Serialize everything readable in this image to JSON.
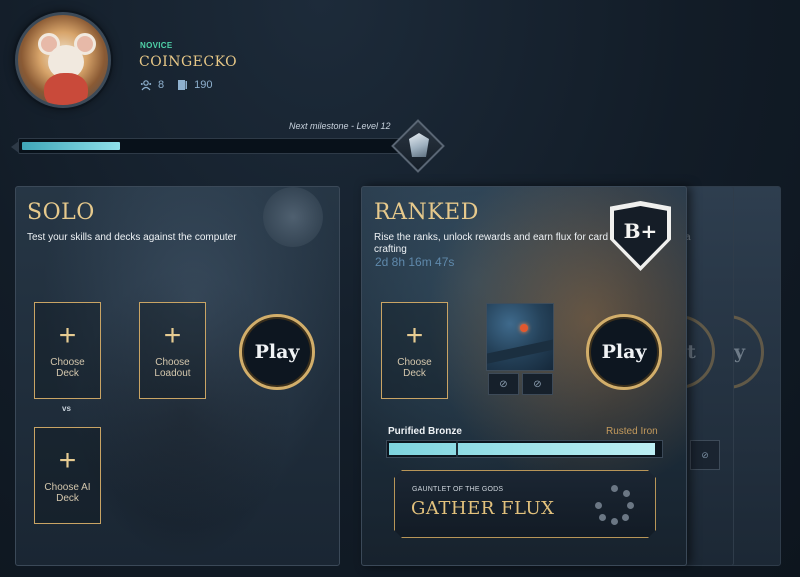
{
  "profile": {
    "rank": "NOVICE",
    "name": "COINGECKO",
    "stats": [
      {
        "icon": "friends-icon",
        "value": "8"
      },
      {
        "icon": "cards-icon",
        "value": "190"
      }
    ]
  },
  "level": {
    "milestone_text": "Next milestone - Level 12",
    "progress": 0.25
  },
  "solo": {
    "title": "SOLO",
    "description": "Test your skills and decks against the computer",
    "slots": [
      {
        "plus": "+",
        "label": "Choose Deck"
      },
      {
        "plus": "+",
        "label": "Choose Loadout"
      },
      {
        "plus": "+",
        "label": "Choose AI Deck"
      }
    ],
    "vs": "vs",
    "play_label": "Play"
  },
  "ranked": {
    "title": "RANKED",
    "description": "Rise the ranks, unlock rewards and earn flux for card crafting",
    "countdown": "2d 8h 16m 47s",
    "grade": "B+",
    "slot": {
      "plus": "+",
      "label": "Choose Deck"
    },
    "mini_buttons": [
      "⊘",
      "⊘"
    ],
    "play_label": "Play",
    "tier_current": "Purified Bronze",
    "tier_next": "Rusted Iron",
    "tier_progress": 0.98,
    "flux": {
      "subtitle": "GAUNTLET OF THE GODS",
      "title": "GATHER FLUX"
    }
  },
  "back_cards": {
    "desc_fragment": "a",
    "glyph_1": "t",
    "glyph_2": "y",
    "slot_icon": "eye-off-icon"
  },
  "colors": {
    "gold": "#d2ae6a",
    "teal": "#7ed4de",
    "rank_green": "#4fd2a8"
  }
}
